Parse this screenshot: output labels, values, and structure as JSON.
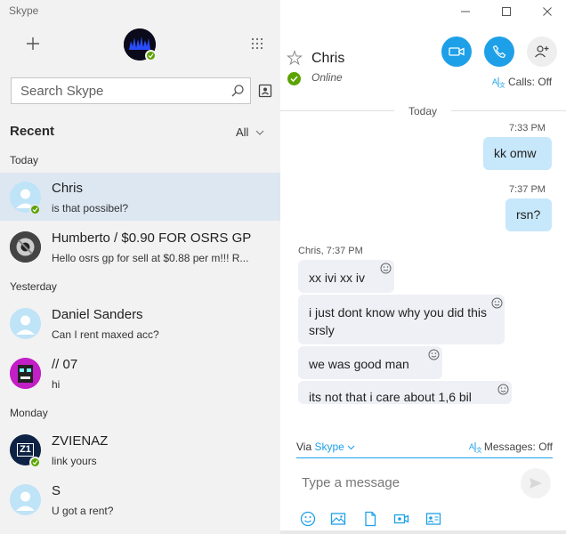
{
  "window": {
    "title": "Skype"
  },
  "sidebar": {
    "search_placeholder": "Search Skype",
    "recent_label": "Recent",
    "filter_label": "All",
    "groups": {
      "today": "Today",
      "yesterday": "Yesterday",
      "monday": "Monday"
    },
    "chats": [
      {
        "name": "Chris",
        "preview": "is that possibel?",
        "online": true,
        "selected": true
      },
      {
        "name": "Humberto / $0.90 FOR OSRS GP",
        "preview": "Hello osrs gp for sell at $0.88 per m!!! R..."
      },
      {
        "name": "Daniel Sanders",
        "preview": "Can I rent maxed acc?"
      },
      {
        "name": "// 07",
        "preview": "hi"
      },
      {
        "name": "ZVIENAZ",
        "preview": "link yours",
        "online": true,
        "avatar_text": "Z1"
      },
      {
        "name": "S",
        "preview": "U got a rent?"
      }
    ]
  },
  "conversation": {
    "contact_name": "Chris",
    "status": "Online",
    "calls_label": "Calls: Off",
    "day_separator": "Today",
    "outgoing": [
      {
        "time": "7:33 PM",
        "text": "kk omw"
      },
      {
        "time": "7:37 PM",
        "text": "rsn?"
      }
    ],
    "incoming_header": "Chris, 7:37 PM",
    "incoming": [
      {
        "text": "xx ivi xx iv"
      },
      {
        "text": "i just dont know why you did this srsly"
      },
      {
        "text": "we was good man"
      },
      {
        "text": "its not that i care about 1,6 bil"
      }
    ]
  },
  "compose": {
    "via_prefix": "Via",
    "via_service": "Skype",
    "messages_label": "Messages: Off",
    "placeholder": "Type a message"
  },
  "colors": {
    "accent": "#1ea0e8",
    "online": "#5ba300",
    "outgoing_bubble": "#c7e7fa",
    "incoming_bubble": "#eef0f5",
    "selected_row": "#dde7f2"
  }
}
